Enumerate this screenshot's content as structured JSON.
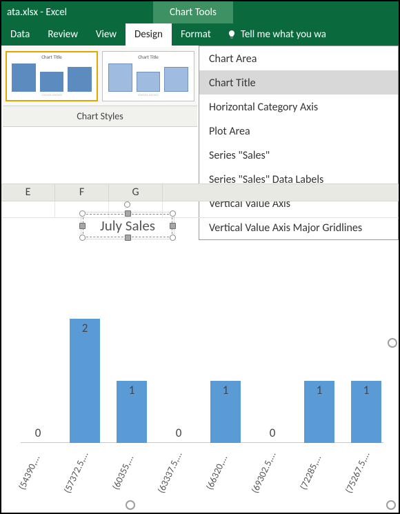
{
  "titlebar": {
    "filename": "ata.xlsx - Excel",
    "contextual_tab": "Chart Tools"
  },
  "ribbon": {
    "tabs": [
      "Data",
      "Review",
      "View",
      "Design",
      "Format"
    ],
    "active_index": 3,
    "tell_me": "Tell me what you wa"
  },
  "gallery": {
    "label": "Chart Styles",
    "thumb_title": "Chart Title",
    "thumb_title2": "Chart Title"
  },
  "dropdown": {
    "items": [
      "Chart Area",
      "Chart Title",
      "Horizontal Category Axis",
      "Plot Area",
      "Series \"Sales\"",
      "Series \"Sales\" Data Labels",
      "Vertical Value Axis",
      "Vertical Value Axis Major Gridlines"
    ],
    "highlighted_index": 1
  },
  "columns": [
    "E",
    "F",
    "G"
  ],
  "chart": {
    "title": "July Sales"
  },
  "chart_data": {
    "type": "bar",
    "title": "July Sales",
    "categories": [
      "(54390,...",
      "(57372.5,...",
      "(60355,...",
      "(63337.5,...",
      "(66320,...",
      "(69302.5,...",
      "(72285,...",
      "(75267.5,..."
    ],
    "values": [
      0,
      2,
      1,
      0,
      1,
      0,
      1,
      1
    ],
    "series_name": "Sales",
    "data_labels": true,
    "xlabel": "",
    "ylabel": "",
    "ylim": [
      0,
      2
    ]
  }
}
